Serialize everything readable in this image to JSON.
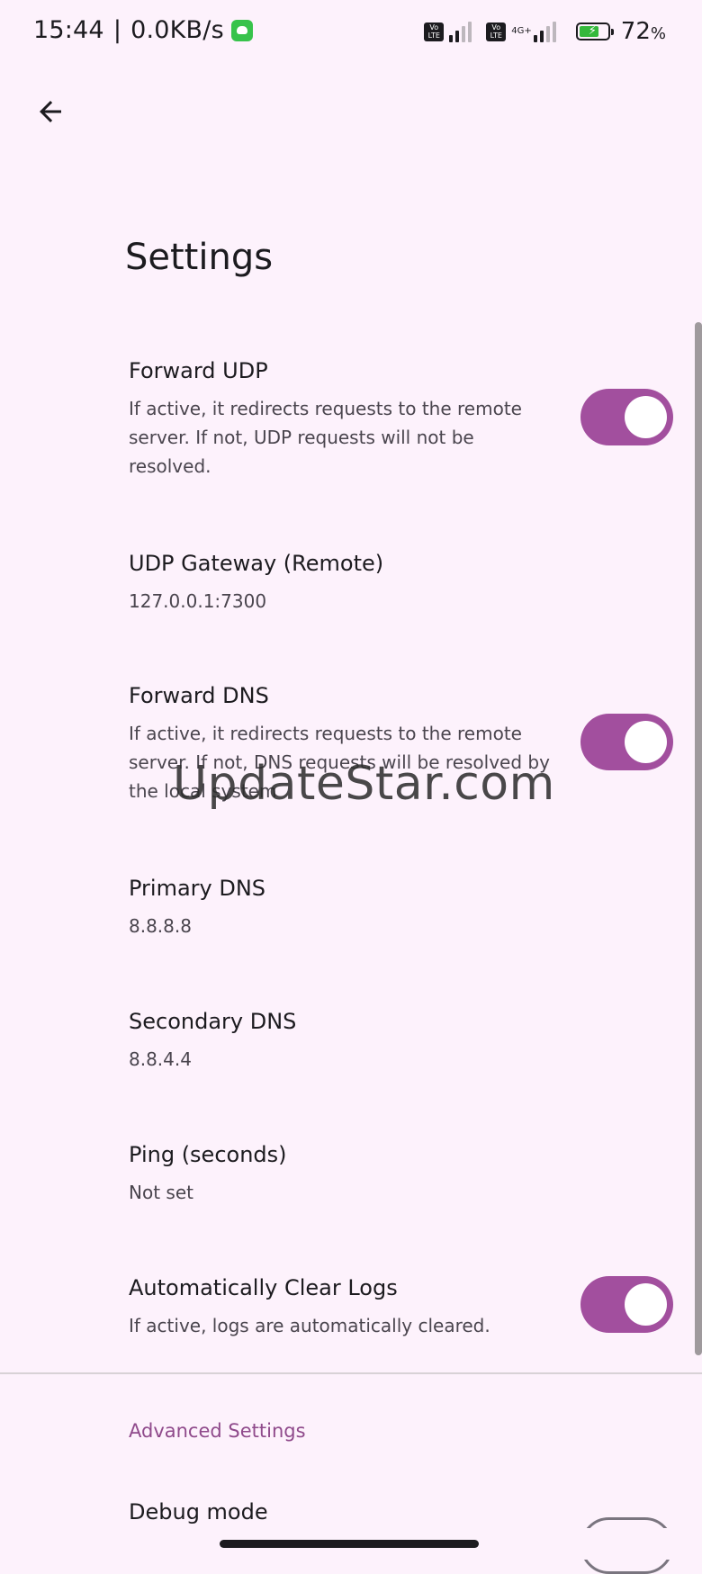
{
  "status_bar": {
    "time": "15:44",
    "separator": "|",
    "net_speed": "0.0KB/s",
    "volte_label_1": "Vo",
    "volte_label_2": "LTE",
    "network_type": "4G+",
    "battery_percent": "72",
    "percent_sign": "%",
    "battery_level": 0.72,
    "battery_color": "#35b83c"
  },
  "header": {
    "back_icon": "arrow-left-icon",
    "title": "Settings"
  },
  "preferences": [
    {
      "title": "Forward UDP",
      "summary": "If active, it redirects requests to the remote server. If not, UDP requests will not be resolved.",
      "toggle": true
    },
    {
      "title": "UDP Gateway (Remote)",
      "summary": "127.0.0.1:7300"
    },
    {
      "title": "Forward DNS",
      "summary": "If active, it redirects requests to the remote server. If not, DNS requests will be resolved by the local system",
      "toggle": true
    },
    {
      "title": "Primary DNS",
      "summary": "8.8.8.8"
    },
    {
      "title": "Secondary DNS",
      "summary": "8.8.4.4"
    },
    {
      "title": "Ping (seconds)",
      "summary": "Not set"
    },
    {
      "title": "Automatically Clear Logs",
      "summary": "If active, logs are automatically cleared.",
      "toggle": true
    }
  ],
  "advanced": {
    "section_title": "Advanced Settings",
    "debug_title": "Debug mode",
    "debug_toggle": false
  },
  "watermark": "UpdateStar.com",
  "colors": {
    "accent": "#a24f9e",
    "section_header": "#8f4a8b",
    "background": "#fdf2fc"
  }
}
